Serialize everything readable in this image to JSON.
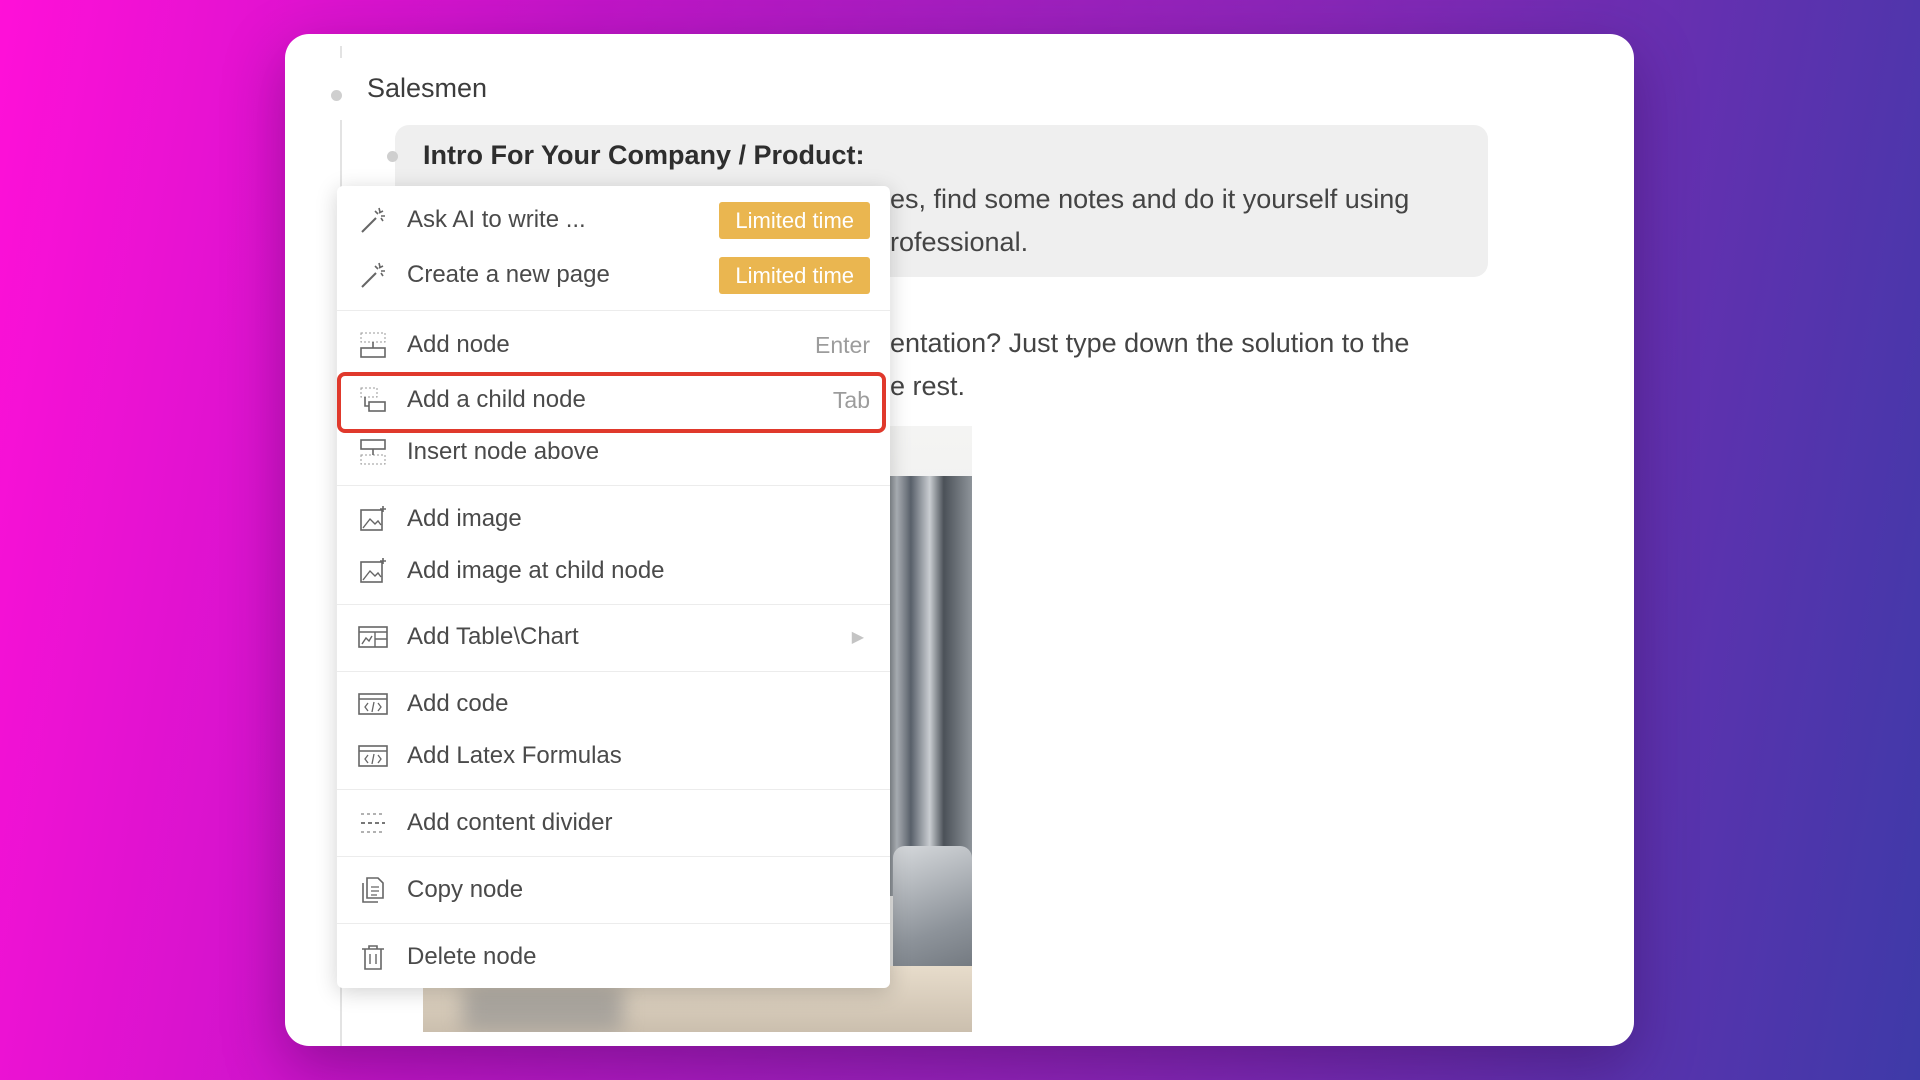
{
  "document": {
    "root_title": "Salesmen",
    "card_title": "Intro For Your Company / Product:",
    "card_line1_visible": "es, find some notes and do it yourself using",
    "card_line2_visible": "rofessional.",
    "para_line1_visible": "entation? Just type down the solution to the",
    "para_line2_visible": "e rest."
  },
  "menu": {
    "ask_ai": {
      "label": "Ask AI to write ...",
      "badge": "Limited time",
      "icon": "magic-wand-icon"
    },
    "new_page": {
      "label": "Create a new page",
      "badge": "Limited time",
      "icon": "magic-wand-icon"
    },
    "add_node": {
      "label": "Add node",
      "shortcut": "Enter",
      "icon": "add-node-icon"
    },
    "add_child": {
      "label": "Add a child node",
      "shortcut": "Tab",
      "icon": "child-node-icon"
    },
    "insert_above": {
      "label": "Insert node above",
      "icon": "insert-above-icon"
    },
    "add_image": {
      "label": "Add image",
      "icon": "image-icon"
    },
    "add_image_child": {
      "label": "Add image at child node",
      "icon": "image-icon"
    },
    "add_table": {
      "label": "Add Table\\Chart",
      "icon": "table-chart-icon",
      "submenu_arrow": "▶"
    },
    "add_code": {
      "label": "Add code",
      "icon": "code-icon"
    },
    "add_latex": {
      "label": "Add Latex Formulas",
      "icon": "code-icon"
    },
    "add_divider": {
      "label": "Add content divider",
      "icon": "divider-icon"
    },
    "copy_node": {
      "label": "Copy node",
      "icon": "copy-icon"
    },
    "delete_node": {
      "label": "Delete node",
      "icon": "trash-icon"
    }
  },
  "colors": {
    "badge": "#eab650",
    "highlight": "#e0392c"
  }
}
